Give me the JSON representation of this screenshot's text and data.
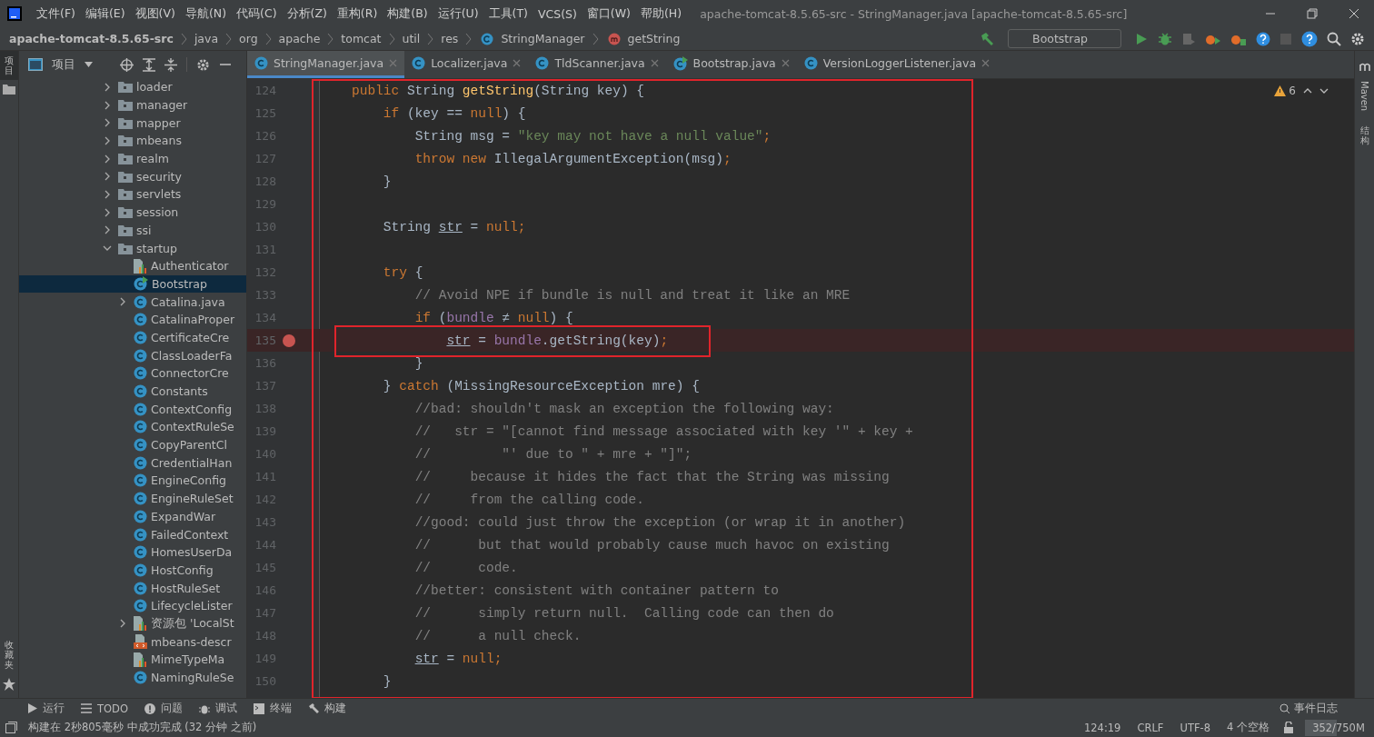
{
  "menu": [
    "文件(F)",
    "编辑(E)",
    "视图(V)",
    "导航(N)",
    "代码(C)",
    "分析(Z)",
    "重构(R)",
    "构建(B)",
    "运行(U)",
    "工具(T)",
    "VCS(S)",
    "窗口(W)",
    "帮助(H)"
  ],
  "window": {
    "title": "apache-tomcat-8.5.65-src - StringManager.java [apache-tomcat-8.5.65-src]"
  },
  "breadcrumb": [
    {
      "kind": "project",
      "text": "apache-tomcat-8.5.65-src"
    },
    {
      "kind": "folder",
      "text": "java"
    },
    {
      "kind": "folder",
      "text": "org"
    },
    {
      "kind": "folder",
      "text": "apache"
    },
    {
      "kind": "folder",
      "text": "tomcat"
    },
    {
      "kind": "folder",
      "text": "util"
    },
    {
      "kind": "folder",
      "text": "res"
    },
    {
      "kind": "class",
      "text": "StringManager"
    },
    {
      "kind": "method",
      "text": "getString"
    }
  ],
  "run_config": "Bootstrap",
  "left_stripe": {
    "top": "项目",
    "bottom": "收藏夹"
  },
  "right_stripe": [
    "Maven",
    "结构"
  ],
  "project_panel": {
    "title": "项目"
  },
  "tree": [
    {
      "kind": "folder",
      "name": "loader",
      "expanded": false,
      "selected": false
    },
    {
      "kind": "folder",
      "name": "manager",
      "expanded": false,
      "selected": false
    },
    {
      "kind": "folder",
      "name": "mapper",
      "expanded": false,
      "selected": false
    },
    {
      "kind": "folder",
      "name": "mbeans",
      "expanded": false,
      "selected": false
    },
    {
      "kind": "folder",
      "name": "realm",
      "expanded": false,
      "selected": false
    },
    {
      "kind": "folder",
      "name": "security",
      "expanded": false,
      "selected": false
    },
    {
      "kind": "folder",
      "name": "servlets",
      "expanded": false,
      "selected": false
    },
    {
      "kind": "folder",
      "name": "session",
      "expanded": false,
      "selected": false
    },
    {
      "kind": "folder",
      "name": "ssi",
      "expanded": false,
      "selected": false
    },
    {
      "kind": "folder",
      "name": "startup",
      "expanded": true,
      "selected": false,
      "children": [
        {
          "kind": "properties",
          "name": "Authenticator",
          "selected": false
        },
        {
          "kind": "main-class",
          "name": "Bootstrap",
          "selected": true
        },
        {
          "kind": "class",
          "name": "Catalina.java",
          "expanded": false,
          "selected": false
        },
        {
          "kind": "class",
          "name": "CatalinaProper",
          "selected": false
        },
        {
          "kind": "class",
          "name": "CertificateCre",
          "selected": false
        },
        {
          "kind": "class",
          "name": "ClassLoaderFa",
          "selected": false
        },
        {
          "kind": "class",
          "name": "ConnectorCre",
          "selected": false
        },
        {
          "kind": "class",
          "name": "Constants",
          "selected": false
        },
        {
          "kind": "class",
          "name": "ContextConfig",
          "selected": false
        },
        {
          "kind": "class",
          "name": "ContextRuleSe",
          "selected": false
        },
        {
          "kind": "class",
          "name": "CopyParentCl",
          "selected": false
        },
        {
          "kind": "class",
          "name": "CredentialHan",
          "selected": false
        },
        {
          "kind": "class",
          "name": "EngineConfig",
          "selected": false
        },
        {
          "kind": "class",
          "name": "EngineRuleSet",
          "selected": false
        },
        {
          "kind": "class",
          "name": "ExpandWar",
          "selected": false
        },
        {
          "kind": "class",
          "name": "FailedContext",
          "selected": false
        },
        {
          "kind": "class",
          "name": "HomesUserDa",
          "selected": false
        },
        {
          "kind": "class",
          "name": "HostConfig",
          "selected": false
        },
        {
          "kind": "class",
          "name": "HostRuleSet",
          "selected": false
        },
        {
          "kind": "class",
          "name": "LifecycleLister",
          "selected": false
        },
        {
          "kind": "properties",
          "name": "资源包 'LocalSt",
          "expanded": false,
          "selected": false
        },
        {
          "kind": "xml",
          "name": "mbeans-descr",
          "selected": false
        },
        {
          "kind": "properties",
          "name": "MimeTypeMa",
          "selected": false
        },
        {
          "kind": "class",
          "name": "NamingRuleSe",
          "selected": false
        }
      ]
    }
  ],
  "tabs": [
    {
      "label": "StringManager.java",
      "kind": "class",
      "selected": true
    },
    {
      "label": "Localizer.java",
      "kind": "class",
      "selected": false
    },
    {
      "label": "TldScanner.java",
      "kind": "class",
      "selected": false
    },
    {
      "label": "Bootstrap.java",
      "kind": "main-class",
      "selected": false
    },
    {
      "label": "VersionLoggerListener.java",
      "kind": "class",
      "selected": false
    }
  ],
  "inspections": {
    "warnings": "6"
  },
  "code": [
    {
      "n": "124",
      "breakpoint": false,
      "tokens": [
        {
          "kind": "kw",
          "text": "public "
        },
        {
          "kind": "plain",
          "text": "String "
        },
        {
          "kind": "decl",
          "text": "getString"
        },
        {
          "kind": "plain",
          "text": "(String key) {"
        }
      ]
    },
    {
      "n": "125",
      "breakpoint": false,
      "tokens": [
        {
          "kind": "kw",
          "text": "    if "
        },
        {
          "kind": "plain",
          "text": "(key == "
        },
        {
          "kind": "kw",
          "text": "null"
        },
        {
          "kind": "plain",
          "text": ") {"
        }
      ]
    },
    {
      "n": "126",
      "breakpoint": false,
      "tokens": [
        {
          "kind": "plain",
          "text": "        String msg = "
        },
        {
          "kind": "str",
          "text": "\"key may not have a null value\""
        },
        {
          "kind": "kw",
          "text": ";"
        }
      ]
    },
    {
      "n": "127",
      "breakpoint": false,
      "tokens": [
        {
          "kind": "kw",
          "text": "        throw new "
        },
        {
          "kind": "plain",
          "text": "IllegalArgumentException(msg)"
        },
        {
          "kind": "kw",
          "text": ";"
        }
      ]
    },
    {
      "n": "128",
      "breakpoint": false,
      "tokens": [
        {
          "kind": "plain",
          "text": "    }"
        }
      ]
    },
    {
      "n": "129",
      "breakpoint": false
    },
    {
      "n": "130",
      "breakpoint": false,
      "tokens": [
        {
          "kind": "plain",
          "text": "    String "
        },
        {
          "kind": "var",
          "text": "str"
        },
        {
          "kind": "plain",
          "text": " = "
        },
        {
          "kind": "kw",
          "text": "null;"
        }
      ]
    },
    {
      "n": "131",
      "breakpoint": false
    },
    {
      "n": "132",
      "breakpoint": false,
      "tokens": [
        {
          "kind": "kw",
          "text": "    try "
        },
        {
          "kind": "plain",
          "text": "{"
        }
      ]
    },
    {
      "n": "133",
      "breakpoint": false,
      "tokens": [
        {
          "kind": "comment",
          "text": "        // Avoid NPE if bundle is null and treat it like an MRE"
        }
      ]
    },
    {
      "n": "134",
      "breakpoint": false,
      "tokens": [
        {
          "kind": "kw",
          "text": "        if "
        },
        {
          "kind": "plain",
          "text": "("
        },
        {
          "kind": "field",
          "text": "bundle"
        },
        {
          "kind": "plain",
          "text": " ≠ "
        },
        {
          "kind": "kw",
          "text": "null"
        },
        {
          "kind": "plain",
          "text": ") {"
        }
      ]
    },
    {
      "n": "135",
      "breakpoint": true,
      "boxed": true,
      "tokens": [
        {
          "kind": "var",
          "text": "            str"
        },
        {
          "kind": "plain",
          "text": " = "
        },
        {
          "kind": "field",
          "text": "bundle"
        },
        {
          "kind": "plain",
          "text": ".getString(key)"
        },
        {
          "kind": "kw",
          "text": ";"
        }
      ]
    },
    {
      "n": "136",
      "breakpoint": false,
      "tokens": [
        {
          "kind": "plain",
          "text": "        }"
        }
      ]
    },
    {
      "n": "137",
      "breakpoint": false,
      "tokens": [
        {
          "kind": "plain",
          "text": "    } "
        },
        {
          "kind": "kw",
          "text": "catch "
        },
        {
          "kind": "plain",
          "text": "(MissingResourceException mre) {"
        }
      ]
    },
    {
      "n": "138",
      "breakpoint": false,
      "tokens": [
        {
          "kind": "comment",
          "text": "        //bad: shouldn't mask an exception the following way:"
        }
      ]
    },
    {
      "n": "139",
      "breakpoint": false,
      "tokens": [
        {
          "kind": "comment",
          "text": "        //   str = \"[cannot find message associated with key '\" + key +"
        }
      ]
    },
    {
      "n": "140",
      "breakpoint": false,
      "tokens": [
        {
          "kind": "comment",
          "text": "        //         \"' due to \" + mre + \"]\";"
        }
      ]
    },
    {
      "n": "141",
      "breakpoint": false,
      "tokens": [
        {
          "kind": "comment",
          "text": "        //     because it hides the fact that the String was missing"
        }
      ]
    },
    {
      "n": "142",
      "breakpoint": false,
      "tokens": [
        {
          "kind": "comment",
          "text": "        //     from the calling code."
        }
      ]
    },
    {
      "n": "143",
      "breakpoint": false,
      "tokens": [
        {
          "kind": "comment",
          "text": "        //good: could just throw the exception (or wrap it in another)"
        }
      ]
    },
    {
      "n": "144",
      "breakpoint": false,
      "tokens": [
        {
          "kind": "comment",
          "text": "        //      but that would probably cause much havoc on existing"
        }
      ]
    },
    {
      "n": "145",
      "breakpoint": false,
      "tokens": [
        {
          "kind": "comment",
          "text": "        //      code."
        }
      ]
    },
    {
      "n": "146",
      "breakpoint": false,
      "tokens": [
        {
          "kind": "comment",
          "text": "        //better: consistent with container pattern to"
        }
      ]
    },
    {
      "n": "147",
      "breakpoint": false,
      "tokens": [
        {
          "kind": "comment",
          "text": "        //      simply return null.  Calling code can then do"
        }
      ]
    },
    {
      "n": "148",
      "breakpoint": false,
      "tokens": [
        {
          "kind": "comment",
          "text": "        //      a null check."
        }
      ]
    },
    {
      "n": "149",
      "breakpoint": false,
      "tokens": [
        {
          "kind": "var",
          "text": "        str"
        },
        {
          "kind": "plain",
          "text": " = "
        },
        {
          "kind": "kw",
          "text": "null;"
        }
      ]
    },
    {
      "n": "150",
      "breakpoint": false,
      "tokens": [
        {
          "kind": "plain",
          "text": "    }"
        }
      ]
    }
  ],
  "tool_windows": [
    {
      "kind": "run",
      "label": "运行"
    },
    {
      "kind": "todo",
      "label": "TODO"
    },
    {
      "kind": "problems",
      "label": "问题"
    },
    {
      "kind": "debug",
      "label": "调试"
    },
    {
      "kind": "terminal",
      "label": "终端"
    },
    {
      "kind": "build",
      "label": "构建"
    }
  ],
  "event_log": "事件日志",
  "status_bar": {
    "message": "构建在 2秒805毫秒 中成功完成 (32 分钟 之前)",
    "position": "124:19",
    "line_separator": "CRLF",
    "encoding": "UTF-8",
    "indent": "4 个空格",
    "memory": {
      "text": "352/750M",
      "level": 0.47
    }
  }
}
